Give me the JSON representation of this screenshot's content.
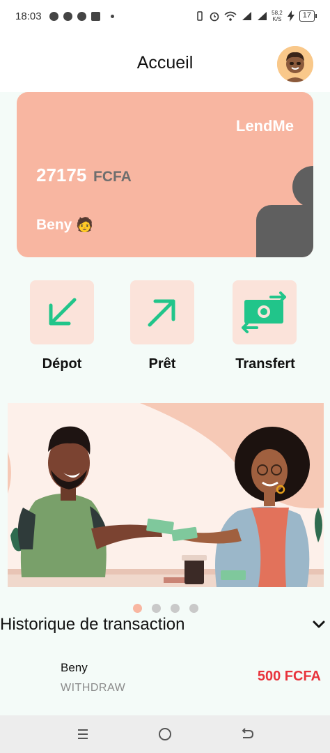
{
  "status_bar": {
    "time": "18:03",
    "net_speed_value": "58,2",
    "net_speed_unit": "K/S",
    "battery": "17"
  },
  "header": {
    "title": "Accueil"
  },
  "card": {
    "brand": "LendMe",
    "balance": "27175",
    "currency": "FCFA",
    "holder": "Beny",
    "holder_emoji": "🧑"
  },
  "actions": [
    {
      "label": "Dépot",
      "icon": "arrow-down-left-icon"
    },
    {
      "label": "Prêt",
      "icon": "arrow-up-right-icon"
    },
    {
      "label": "Transfert",
      "icon": "money-transfer-icon"
    }
  ],
  "carousel": {
    "slide_count": 4,
    "active_index": 0
  },
  "history": {
    "title": "Historique de transaction",
    "items": [
      {
        "name": "Beny",
        "type": "WITHDRAW",
        "amount": "500 FCFA"
      }
    ]
  },
  "colors": {
    "card": "#f8b6a1",
    "accent_green": "#21c58a",
    "tile": "#fbe3da",
    "amount_red": "#e8333c"
  }
}
